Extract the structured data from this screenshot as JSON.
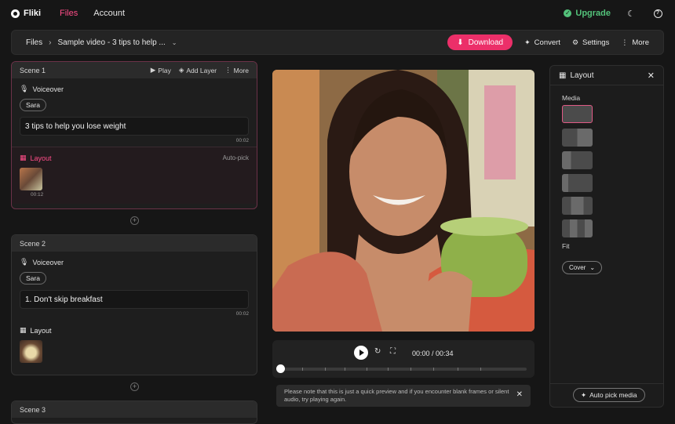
{
  "nav": {
    "logo": "Fliki",
    "files": "Files",
    "account": "Account",
    "upgrade": "Upgrade"
  },
  "toolbar": {
    "crumb_root": "Files",
    "crumb_current": "Sample video - 3 tips to help ...",
    "download": "Download",
    "convert": "Convert",
    "settings": "Settings",
    "more": "More"
  },
  "scenes": [
    {
      "title": "Scene 1",
      "play": "Play",
      "add_layer": "Add Layer",
      "more": "More",
      "voiceover": "Voiceover",
      "voice": "Sara",
      "text": "3 tips to help you lose weight",
      "text_duration": "00:02",
      "layout": "Layout",
      "autopick": "Auto-pick",
      "media_duration": "00:12"
    },
    {
      "title": "Scene 2",
      "voiceover": "Voiceover",
      "voice": "Sara",
      "text": "1. Don't skip breakfast",
      "text_duration": "00:02",
      "layout": "Layout"
    },
    {
      "title": "Scene 3"
    }
  ],
  "player": {
    "time": "00:00 / 00:34",
    "progress": 0
  },
  "notice": "Please note that this is just a quick preview and if you encounter blank frames or silent audio, try playing again.",
  "layout_panel": {
    "title": "Layout",
    "media_label": "Media",
    "fit_label": "Fit",
    "fit_value": "Cover",
    "auto_pick": "Auto pick media"
  },
  "colors": {
    "accent": "#ec2f69",
    "upgrade": "#53c27a"
  }
}
